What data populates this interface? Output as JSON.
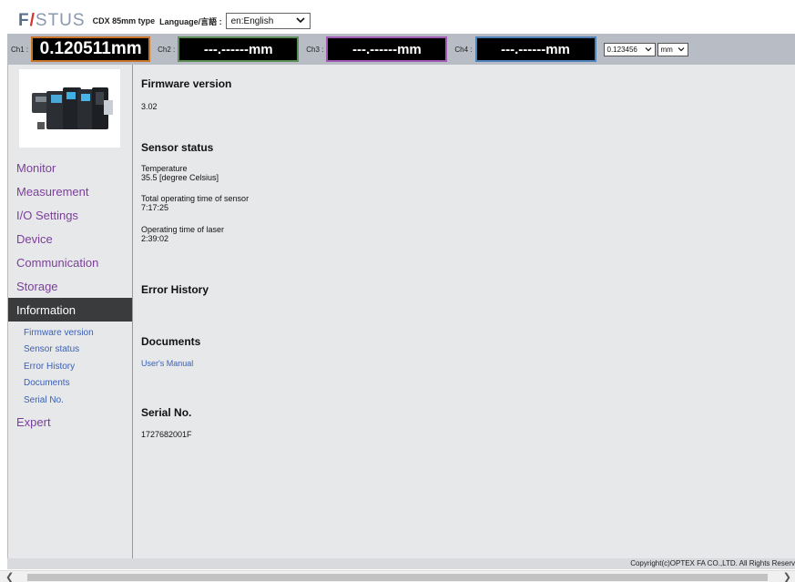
{
  "header": {
    "logo_text": "FASTUS",
    "model": "CDX 85mm type",
    "language_label": "Language/言語 :",
    "language_value": "en:English"
  },
  "channels": [
    {
      "label": "Ch1 :",
      "value": "0.120511mm"
    },
    {
      "label": "Ch2 :",
      "value": "---.------mm"
    },
    {
      "label": "Ch3 :",
      "value": "---.------mm"
    },
    {
      "label": "Ch4 :",
      "value": "---.------mm"
    }
  ],
  "display_controls": {
    "precision_value": "0.123456",
    "unit_value": "mm"
  },
  "sidebar": {
    "items": [
      {
        "label": "Monitor"
      },
      {
        "label": "Measurement"
      },
      {
        "label": "I/O Settings"
      },
      {
        "label": "Device"
      },
      {
        "label": "Communication"
      },
      {
        "label": "Storage"
      },
      {
        "label": "Information"
      },
      {
        "label": "Expert"
      }
    ],
    "subitems": [
      {
        "label": "Firmware version"
      },
      {
        "label": "Sensor status"
      },
      {
        "label": "Error History"
      },
      {
        "label": "Documents"
      },
      {
        "label": "Serial No."
      }
    ]
  },
  "main": {
    "firmware_title": "Firmware version",
    "firmware_value": "3.02",
    "sensor_title": "Sensor status",
    "temperature_label": "Temperature",
    "temperature_value": "35.5 [degree Celsius]",
    "sensor_time_label": "Total operating time of sensor",
    "sensor_time_value": "7:17:25",
    "laser_time_label": "Operating time of laser",
    "laser_time_value": "2:39:02",
    "error_title": "Error History",
    "documents_title": "Documents",
    "users_manual": "User's Manual",
    "serial_title": "Serial No.",
    "serial_value": "1727682001F"
  },
  "footer": {
    "copyright": "Copyright(c)OPTEX FA CO.,LTD. All Rights Reserv"
  },
  "colors": {
    "ch1_border": "#c8742a",
    "ch2_border": "#5b8f56",
    "ch3_border": "#a25bb5",
    "ch4_border": "#4f82b9",
    "nav_text": "#7b3f9a",
    "link": "#3b5fb5"
  }
}
